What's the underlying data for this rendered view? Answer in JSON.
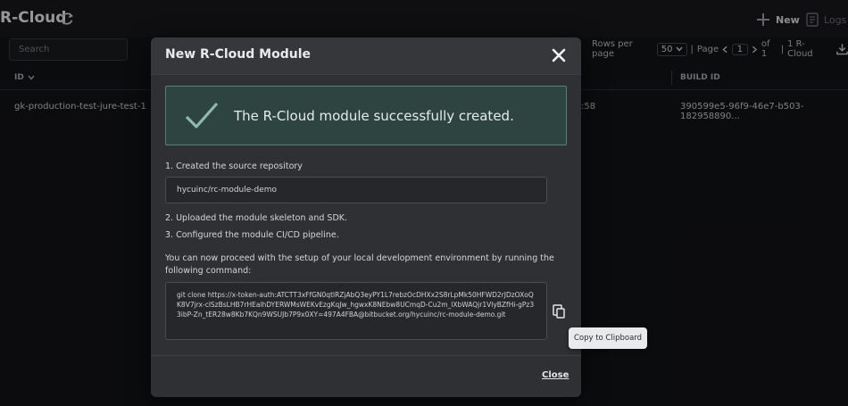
{
  "app": {
    "title": "R-Cloud",
    "new_label": "New",
    "logs_label": "Logs",
    "search_placeholder": "Search"
  },
  "pager": {
    "rows_per_page_label": "Rows per page",
    "rows_per_page_value": "50",
    "sep1": "|",
    "page_label": "Page",
    "page_value": "1",
    "of_label": "of 1",
    "sep2": "|",
    "count_label": "1 R-Cloud"
  },
  "table": {
    "columns": [
      {
        "label": "ID"
      },
      {
        "label": "BUILD ID"
      }
    ],
    "row": {
      "id": "gk-production-test-jure-test-1",
      "time_fragment": ":58",
      "build_id": "390599e5-96f9-46e7-b503-182958890..."
    }
  },
  "modal": {
    "title": "New R-Cloud Module",
    "success_message": "The R-Cloud module successfully created.",
    "step1": "1. Created the source repository",
    "repo_value": "hycuinc/rc-module-demo",
    "step2": "2. Uploaded the module skeleton and SDK.",
    "step3": "3. Configured the module CI/CD pipeline.",
    "instructions": "You can now proceed with the setup of your local development environment by running the following command:",
    "command": "git clone https://x-token-auth:ATCTT3xFfGN0qtlRZjAbQ3eyPY1L7rebzOcDHXx2S8rLpMk50HFWD2rJDzOXoQK8V7jrx-clSzBsLHB7rHEalhDYERWMsWEKvEzgKqJw_hgwxK8NEbw8UCmqD-Cu2m_lXbWAQjr1VlyBZfHi-gPz33ibP-Zn_tER28w8Kb7KQn9WSUJb7P9x0XY=497A4FBA@bitbucket.org/hycuinc/rc-module-demo.git",
    "close_label": "Close",
    "tooltip": "Copy to Clipboard"
  },
  "colors": {
    "success_bg": "#2e4440",
    "success_border": "#5a7f78",
    "check": "#8fb8b0"
  }
}
